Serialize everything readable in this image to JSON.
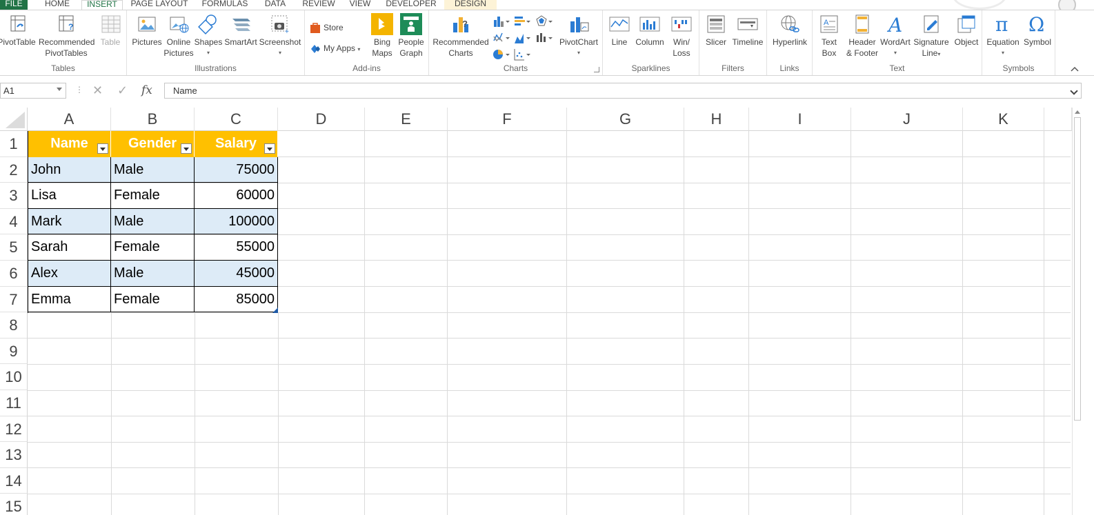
{
  "tabs": [
    {
      "id": "file",
      "label": "FILE"
    },
    {
      "id": "home",
      "label": "HOME"
    },
    {
      "id": "insert",
      "label": "INSERT"
    },
    {
      "id": "page-layout",
      "label": "PAGE LAYOUT"
    },
    {
      "id": "formulas",
      "label": "FORMULAS"
    },
    {
      "id": "data",
      "label": "DATA"
    },
    {
      "id": "review",
      "label": "REVIEW"
    },
    {
      "id": "view",
      "label": "VIEW"
    },
    {
      "id": "developer",
      "label": "DEVELOPER"
    },
    {
      "id": "design",
      "label": "DESIGN"
    }
  ],
  "active_tab": "INSERT",
  "ribbon": {
    "tables": {
      "label": "Tables",
      "pivottable": "PivotTable",
      "recommended_1": "Recommended",
      "recommended_2": "PivotTables",
      "table": "Table"
    },
    "illustrations": {
      "label": "Illustrations",
      "pictures": "Pictures",
      "online_1": "Online",
      "online_2": "Pictures",
      "shapes": "Shapes",
      "smartart": "SmartArt",
      "screenshot": "Screenshot"
    },
    "addins": {
      "label": "Add-ins",
      "store": "Store",
      "myapps": "My Apps",
      "bing_1": "Bing",
      "bing_2": "Maps",
      "people_1": "People",
      "people_2": "Graph"
    },
    "charts": {
      "label": "Charts",
      "rec_1": "Recommended",
      "rec_2": "Charts",
      "pivotchart": "PivotChart"
    },
    "sparklines": {
      "label": "Sparklines",
      "line": "Line",
      "column": "Column",
      "winloss_1": "Win/",
      "winloss_2": "Loss"
    },
    "filters": {
      "label": "Filters",
      "slicer": "Slicer",
      "timeline": "Timeline"
    },
    "links": {
      "label": "Links",
      "hyperlink": "Hyperlink"
    },
    "text": {
      "label": "Text",
      "textbox_1": "Text",
      "textbox_2": "Box",
      "header_1": "Header",
      "header_2": "& Footer",
      "wordart": "WordArt",
      "signature_1": "Signature",
      "signature_2": "Line",
      "object": "Object"
    },
    "symbols": {
      "label": "Symbols",
      "equation": "Equation",
      "symbol": "Symbol"
    }
  },
  "formula_bar": {
    "name_box": "A1",
    "dots": "⋮",
    "cancel": "✕",
    "enter": "✓",
    "fx": "fx",
    "value": "Name"
  },
  "columns": [
    "A",
    "B",
    "C",
    "D",
    "E",
    "F",
    "G",
    "H",
    "I",
    "J",
    "K"
  ],
  "rows": [
    "1",
    "2",
    "3",
    "4",
    "5",
    "6",
    "7",
    "8",
    "9",
    "10",
    "11",
    "12",
    "13",
    "14",
    "15"
  ],
  "table": {
    "headers": [
      "Name",
      "Gender",
      "Salary"
    ],
    "rows": [
      [
        "John",
        "Male",
        "75000"
      ],
      [
        "Lisa",
        "Female",
        "60000"
      ],
      [
        "Mark",
        "Male",
        "100000"
      ],
      [
        "Sarah",
        "Female",
        "55000"
      ],
      [
        "Alex",
        "Male",
        "45000"
      ],
      [
        "Emma",
        "Female",
        "85000"
      ]
    ]
  },
  "colors": {
    "file_tab": "#217346",
    "table_header": "#ffc000",
    "table_band": "#ddebf7"
  }
}
